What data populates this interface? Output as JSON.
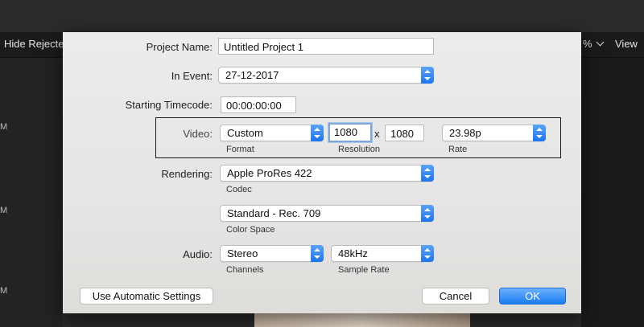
{
  "background": {
    "toolbar_left": "Hide Rejecte",
    "toolbar_pct": "%",
    "toolbar_right": "View",
    "side_labels": [
      "M",
      "M",
      "M"
    ]
  },
  "dialog": {
    "project_name": {
      "label": "Project Name:",
      "value": "Untitled Project 1"
    },
    "in_event": {
      "label": "In Event:",
      "value": "27-12-2017"
    },
    "starting_timecode": {
      "label": "Starting Timecode:",
      "value": "00:00:00:00"
    },
    "video": {
      "label": "Video:",
      "format": {
        "value": "Custom",
        "caption": "Format"
      },
      "resolution": {
        "width": "1080",
        "separator": "x",
        "height": "1080",
        "caption": "Resolution"
      },
      "rate": {
        "value": "23.98p",
        "caption": "Rate"
      }
    },
    "rendering": {
      "label": "Rendering:",
      "codec": {
        "value": "Apple ProRes 422",
        "caption": "Codec"
      },
      "color_space": {
        "value": "Standard - Rec. 709",
        "caption": "Color Space"
      }
    },
    "audio": {
      "label": "Audio:",
      "channels": {
        "value": "Stereo",
        "caption": "Channels"
      },
      "sample_rate": {
        "value": "48kHz",
        "caption": "Sample Rate"
      }
    },
    "buttons": {
      "auto_settings": "Use Automatic Settings",
      "cancel": "Cancel",
      "ok": "OK"
    }
  },
  "colors": {
    "accent": "#1c75ef",
    "dialog_bg": "#ececec"
  }
}
